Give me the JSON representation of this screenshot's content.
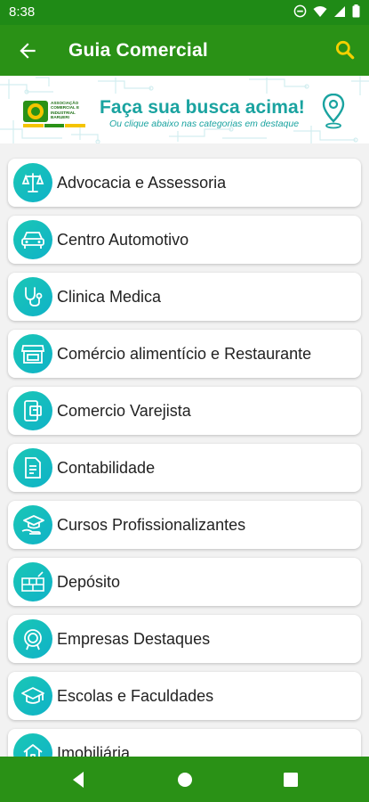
{
  "status_bar": {
    "time": "8:38"
  },
  "app_bar": {
    "title": "Guia Comercial"
  },
  "banner": {
    "logo_text": "ASSOCIAÇÃO COMERCIAL E INDUSTRIAL BARUERI",
    "headline": "Faça sua busca acima!",
    "subline": "Ou clique abaixo nas categorias em destaque"
  },
  "categories": [
    {
      "label": "Advocacia e Assessoria",
      "icon": "scales-icon"
    },
    {
      "label": "Centro Automotivo",
      "icon": "car-icon"
    },
    {
      "label": "Clinica Medica",
      "icon": "stethoscope-icon"
    },
    {
      "label": "Comércio alimentício e Restaurante",
      "icon": "storefront-icon"
    },
    {
      "label": "Comercio Varejista",
      "icon": "shop-phone-icon"
    },
    {
      "label": "Contabilidade",
      "icon": "document-icon"
    },
    {
      "label": "Cursos Profissionalizantes",
      "icon": "graduation-hand-icon"
    },
    {
      "label": "Depósito",
      "icon": "bricks-icon"
    },
    {
      "label": "Empresas Destaques",
      "icon": "badge-icon"
    },
    {
      "label": "Escolas e Faculdades",
      "icon": "graduation-cap-icon"
    },
    {
      "label": "Imobiliária",
      "icon": "house-icon"
    }
  ],
  "colors": {
    "primary": "#2a9116",
    "status_bar": "#1f8a16",
    "accent_yellow": "#f4c400",
    "icon_teal": "#1ac7b5",
    "banner_text": "#1aa3a0"
  }
}
